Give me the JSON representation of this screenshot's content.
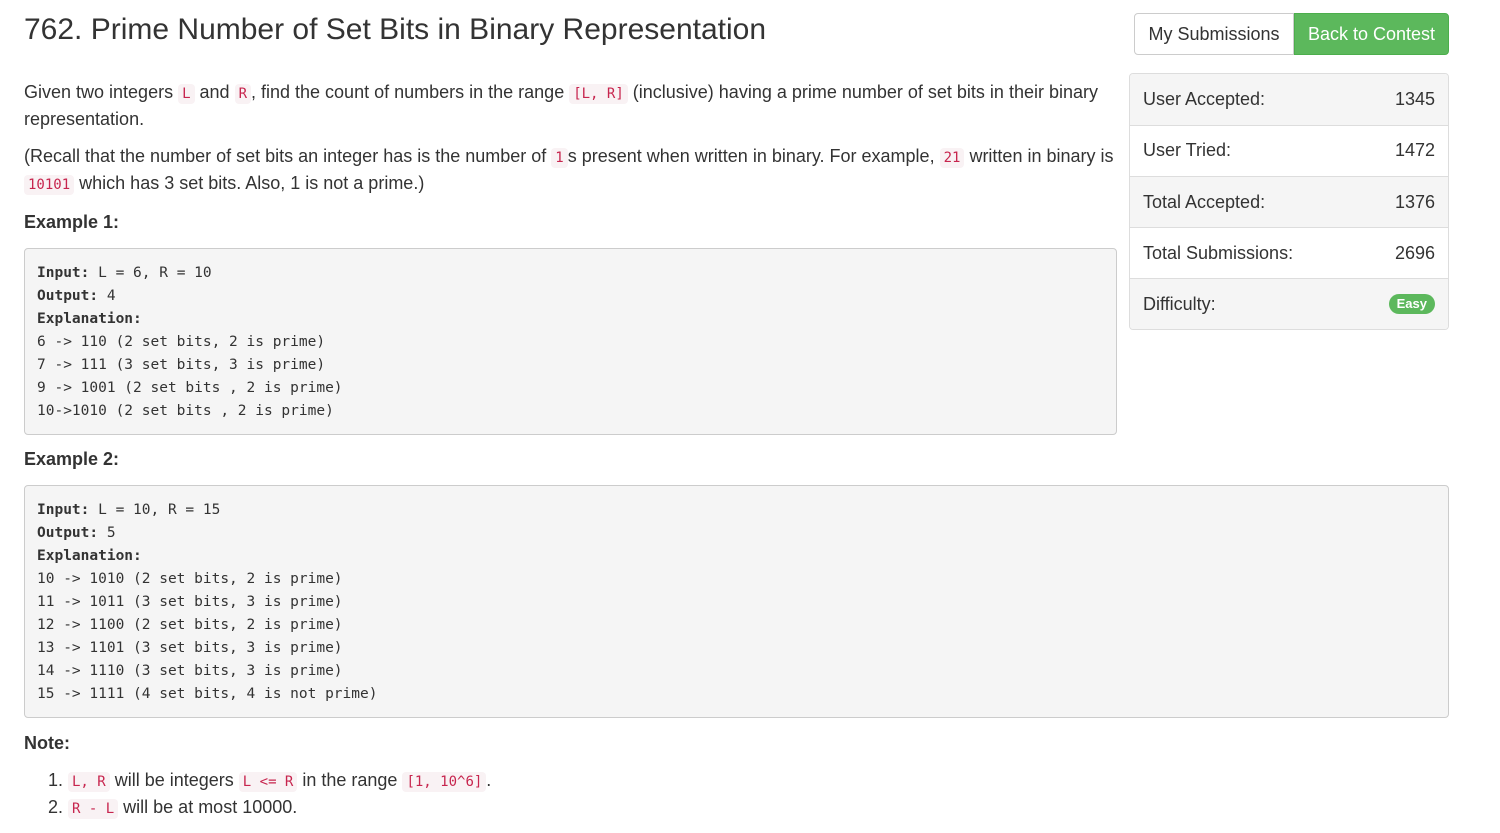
{
  "problem": {
    "title": "762. Prime Number of Set Bits in Binary Representation"
  },
  "buttons": {
    "my_submissions": "My Submissions",
    "back_to_contest": "Back to Contest"
  },
  "description": {
    "p1": {
      "t1": "Given two integers ",
      "c1": "L",
      "t2": " and ",
      "c2": "R",
      "t3": ", find the count of numbers in the range ",
      "c3": "[L, R]",
      "t4": " (inclusive) having a prime number of set bits in their binary representation."
    },
    "p2": {
      "t1": "(Recall that the number of set bits an integer has is the number of ",
      "c1": "1",
      "t2": "s present when written in binary. For example, ",
      "c2": "21",
      "t3": " written in binary is ",
      "c3": "10101",
      "t4": " which has 3 set bits. Also, 1 is not a prime.)"
    }
  },
  "examples": [
    {
      "heading": "Example 1:",
      "input_label": "Input:",
      "input_value": " L = 6, R = 10",
      "output_label": "Output:",
      "output_value": " 4",
      "explanation_label": "Explanation:",
      "lines": [
        "6 -> 110 (2 set bits, 2 is prime)",
        "7 -> 111 (3 set bits, 3 is prime)",
        "9 -> 1001 (2 set bits , 2 is prime)",
        "10->1010 (2 set bits , 2 is prime)"
      ]
    },
    {
      "heading": "Example 2:",
      "input_label": "Input:",
      "input_value": " L = 10, R = 15",
      "output_label": "Output:",
      "output_value": " 5",
      "explanation_label": "Explanation:",
      "lines": [
        "10 -> 1010 (2 set bits, 2 is prime)",
        "11 -> 1011 (3 set bits, 3 is prime)",
        "12 -> 1100 (2 set bits, 2 is prime)",
        "13 -> 1101 (3 set bits, 3 is prime)",
        "14 -> 1110 (3 set bits, 3 is prime)",
        "15 -> 1111 (4 set bits, 4 is not prime)"
      ]
    }
  ],
  "stats": {
    "user_accepted_label": "User Accepted:",
    "user_accepted_value": "1345",
    "user_tried_label": "User Tried:",
    "user_tried_value": "1472",
    "total_accepted_label": "Total Accepted:",
    "total_accepted_value": "1376",
    "total_submissions_label": "Total Submissions:",
    "total_submissions_value": "2696",
    "difficulty_label": "Difficulty:",
    "difficulty_value": "Easy"
  },
  "note": {
    "heading": "Note:",
    "item1": {
      "c1": "L, R",
      "t1": " will be integers ",
      "c2": "L <= R",
      "t2": " in the range ",
      "c3": "[1, 10^6]",
      "t3": "."
    },
    "item2": {
      "c1": "R - L",
      "t1": " will be at most 10000."
    }
  },
  "colors": {
    "success": "#5cb85c",
    "code_text": "#c7254e",
    "code_bg": "#f9f2f4",
    "pre_bg": "#f5f5f5"
  }
}
